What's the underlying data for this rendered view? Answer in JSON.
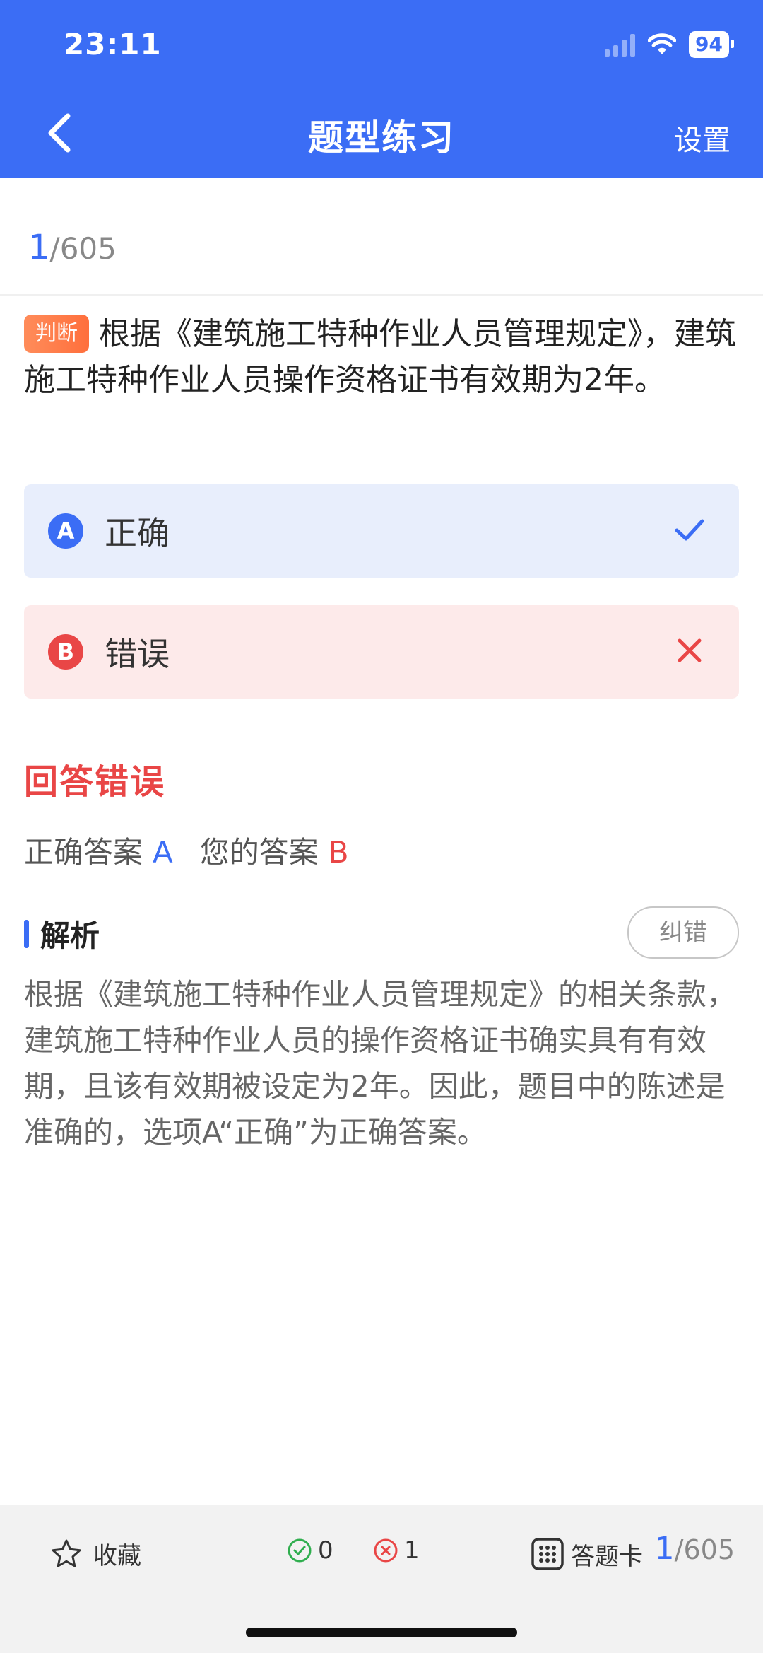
{
  "status": {
    "time": "23:11",
    "battery": "94"
  },
  "nav": {
    "title": "题型练习",
    "settings": "设置"
  },
  "progress": {
    "current": "1",
    "total": "/605"
  },
  "question": {
    "type_tag": "判断",
    "text": "根据《建筑施工特种作业人员管理规定》，建筑施工特种作业人员操作资格证书有效期为2年。"
  },
  "options": [
    {
      "letter": "A",
      "label": "正确",
      "state": "correct"
    },
    {
      "letter": "B",
      "label": "错误",
      "state": "wrong"
    }
  ],
  "result": {
    "title": "回答错误",
    "correct_label": "正确答案",
    "correct_value": "A",
    "yours_label": "您的答案",
    "yours_value": "B"
  },
  "analysis": {
    "title": "解析",
    "report_button": "纠错",
    "text": "根据《建筑施工特种作业人员管理规定》的相关条款，建筑施工特种作业人员的操作资格证书确实具有有效期，且该有效期被设定为2年。因此，题目中的陈述是准确的，选项A“正确”为正确答案。"
  },
  "bottom": {
    "favorite": "收藏",
    "right_count": "0",
    "wrong_count": "1",
    "answer_card": "答题卡",
    "current": "1",
    "total": "/605"
  },
  "colors": {
    "primary": "#3b6df5",
    "error": "#e94646",
    "tag": "#ff7a45",
    "success": "#2fae4e"
  }
}
